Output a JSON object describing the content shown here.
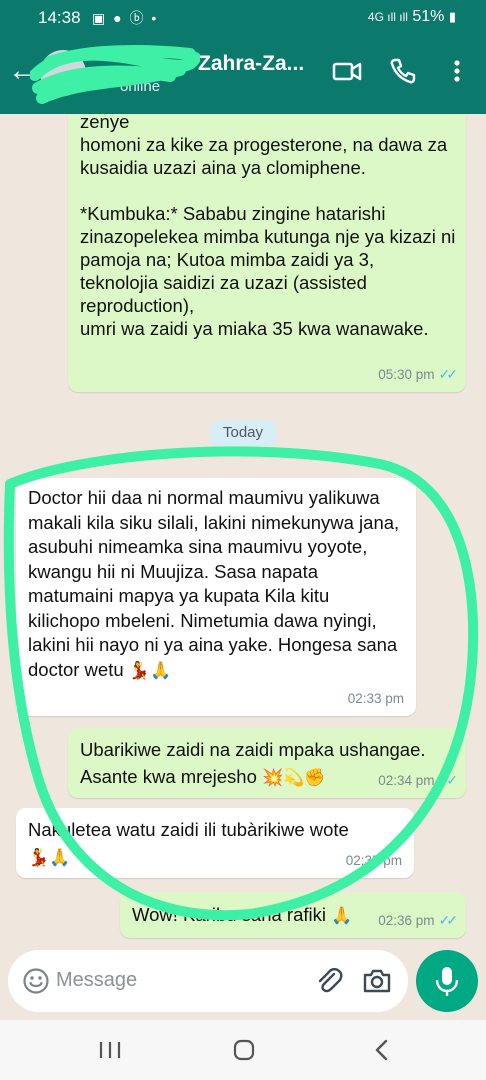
{
  "status_bar": {
    "time": "14:38",
    "notification_icons": "▣ ● ⓑ •",
    "network": "4G ıll ıll",
    "battery": "51%"
  },
  "header": {
    "contact_name": "Zahra-Za...",
    "status": "online"
  },
  "messages": [
    {
      "id": "m1",
      "direction": "out",
      "text": "zenye\nhomoni za kike za progesterone, na dawa za kusaidia uzazi aina ya clomiphene.\n\n*Kumbuka:* Sababu zingine hatarishi zinazopelekea mimba kutunga nje ya kizazi ni\npamoja na; Kutoa mimba zaidi ya 3, teknolojia saidizi za uzazi (assisted reproduction),\numri wa zaidi ya miaka 35 kwa wanawake.",
      "time": "05:30 pm",
      "read": "✓✓"
    },
    {
      "id": "m2",
      "direction": "in",
      "text": "Doctor hii daa ni normal maumivu yalikuwa makali kila siku silali, lakini nimekunywa jana, asubuhi nimeamka sina maumivu yoyote, kwangu hii ni Muujiza. Sasa napata matumaini mapya ya kupata Kila kitu kilichopo mbeleni. Nimetumia dawa nyingi, lakini hii nayo ni ya aina yake. Hongesa sana doctor wetu",
      "emoji": "💃🙏",
      "time": "02:33 pm"
    },
    {
      "id": "m3",
      "direction": "out",
      "text": "Ubarikiwe zaidi na zaidi mpaka ushangae. Asante kwa mrejesho",
      "emoji": "💥💫✊",
      "time": "02:34 pm",
      "read": "✓✓"
    },
    {
      "id": "m4",
      "direction": "in",
      "text": "Nakuletea watu zaidi ili tubàrikiwe wote",
      "emoji": "💃🙏",
      "time": "02:35 pm"
    },
    {
      "id": "m5",
      "direction": "out",
      "text": "Wow! Karibu sana rafiki",
      "emoji": "🙏",
      "time": "02:36 pm",
      "read": "✓✓"
    }
  ],
  "day_separator": "Today",
  "composer": {
    "placeholder": "Message"
  },
  "colors": {
    "header": "#0b7a6d",
    "outgoing_bubble": "#dcf8c6",
    "incoming_bubble": "#ffffff",
    "chat_background": "#efe7de",
    "mic_button": "#00a884",
    "read_ticks": "#53bdeb",
    "annotation_circle": "#3ef0a6"
  },
  "icons": {
    "header": [
      "back-arrow-icon",
      "video-call-icon",
      "phone-icon",
      "more-options-icon"
    ],
    "composer": [
      "emoji-icon",
      "attach-icon",
      "camera-icon",
      "mic-icon"
    ],
    "navigation": [
      "recent-apps-icon",
      "home-icon",
      "back-icon"
    ]
  }
}
